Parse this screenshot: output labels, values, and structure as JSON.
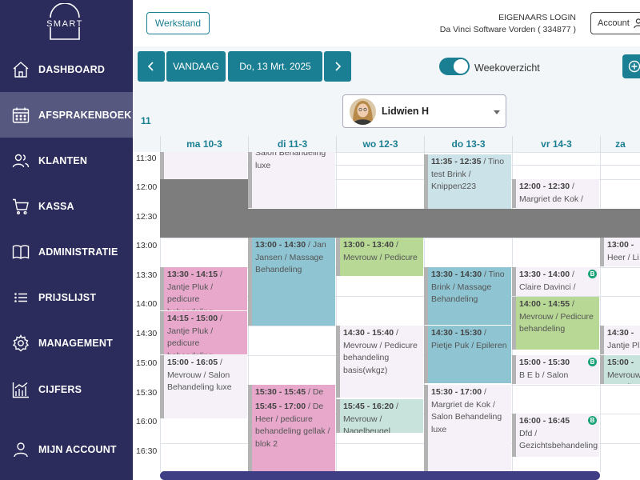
{
  "app": {
    "logo_text": "SMART"
  },
  "sidebar": {
    "items": [
      {
        "label": "DASHBOARD",
        "icon": "home-icon"
      },
      {
        "label": "AFSPRAKENBOEK",
        "icon": "calendar-icon",
        "active": true
      },
      {
        "label": "KLANTEN",
        "icon": "users-icon"
      },
      {
        "label": "KASSA",
        "icon": "cart-icon"
      },
      {
        "label": "ADMINISTRATIE",
        "icon": "book-icon"
      },
      {
        "label": "PRIJSLIJST",
        "icon": "list-icon"
      },
      {
        "label": "MANAGEMENT",
        "icon": "gear-icon"
      },
      {
        "label": "CIJFERS",
        "icon": "chart-icon"
      },
      {
        "label": "MIJN ACCOUNT",
        "icon": "user-icon"
      }
    ]
  },
  "header": {
    "werkstand": "Werkstand",
    "owner_title": "EIGENAARS LOGIN",
    "owner_company": "Da Vinci Software Vorden ( 334877 )",
    "account": "Account"
  },
  "toolbar": {
    "vandaag": "VANDAAG",
    "date": "Do, 13 Mrt. 2025",
    "week_toggle_label": "Weekoverzicht",
    "week_toggle_on": true
  },
  "calendar": {
    "week_number": "11",
    "staff_name": "Lidwien H",
    "days": [
      "ma 10-3",
      "di 11-3",
      "wo 12-3",
      "do 13-3",
      "vr 14-3",
      "za"
    ],
    "times": [
      "11:30",
      "12:00",
      "12:30",
      "13:00",
      "13:30",
      "14:00",
      "14:30",
      "15:00",
      "15:30",
      "16:00",
      "16:30"
    ],
    "appointments": [
      {
        "time": "",
        "text": "Salon Behandeling luxe",
        "color": "#f6f1f9",
        "bar": "#b3b3b3"
      },
      {
        "time": "11:35 - 12:35",
        "text": "Tino test Brink / Knippen223",
        "color": "#cce2e9",
        "bar": "#b3b3b3"
      },
      {
        "time": "12:00 - 12:30",
        "text": "Margriet de Kok /",
        "color": "#f6f1f9",
        "bar": "#b3b3b3"
      },
      {
        "time": "13:00 - 14:30",
        "text": "Jan Jansen / Massage Behandeling",
        "color": "#8fc5d3",
        "bar": "#b3b3b3"
      },
      {
        "time": "13:00 - 13:40",
        "text": "Mevrouw / Pedicure",
        "color": "#b7d995",
        "bar": "#b3b3b3"
      },
      {
        "time": "13:30 - 14:30",
        "text": "Tino Brink / Massage Behandeling",
        "color": "#8fc5d3",
        "bar": "#b3b3b3"
      },
      {
        "time": "13:30 - 14:00",
        "text": "Claire Davinci /",
        "color": "#f6f1f9",
        "bar": "#b3b3b3",
        "badge": "B"
      },
      {
        "time": "13:30 - 14:15",
        "text": "Jantje Pluk / pedicure behandeling",
        "color": "#e7a8cb",
        "bar": "#b3b3b3"
      },
      {
        "time": "14:00 - 14:55",
        "text": "Mevrouw / Pedicure behandeling",
        "color": "#b7d995",
        "bar": "#b3b3b3"
      },
      {
        "time": "14:15 - 15:00",
        "text": "Jantje Pluk / pedicure behandeling",
        "color": "#e7a8cb",
        "bar": "#b3b3b3"
      },
      {
        "time": "14:30 - 15:40",
        "text": "Mevrouw / Pedicure behandeling basis(wkgz)",
        "color": "#f6f1f9",
        "bar": "#b3b3b3"
      },
      {
        "time": "14:30 - 15:30",
        "text": "Pietje Puk / Epileren",
        "color": "#8fc5d3",
        "bar": "#b3b3b3"
      },
      {
        "time": "15:00 - 15:30",
        "text": "B E b / Salon",
        "color": "#f6f1f9",
        "bar": "#b3b3b3",
        "badge": "B"
      },
      {
        "time": "15:00 - 16:05",
        "text": "Mevrouw / Salon Behandeling luxe",
        "color": "#f6f1f9",
        "bar": "#b3b3b3"
      },
      {
        "time": "15:30 - 15:45",
        "text": "De",
        "color": "#e7a8cb",
        "bar": "#b3b3b3"
      },
      {
        "time": "15:30 - 17:00",
        "text": "Margriet de Kok / Salon Behandeling luxe",
        "color": "#f6f1f9",
        "bar": "#b3b3b3"
      },
      {
        "time": "15:45 - 17:00",
        "text": "De Heer / pedicure behandeling gellak / blok 2",
        "color": "#e7a8cb",
        "bar": "#b3b3b3"
      },
      {
        "time": "15:45 - 16:20",
        "text": "Mevrouw / Nagelbeugel",
        "color": "#c8e3dc",
        "bar": "#b3b3b3"
      },
      {
        "time": "16:00 - 16:45",
        "text": "Dfd / Gezichtsbehandeling",
        "color": "#f6f1f9",
        "bar": "#b3b3b3",
        "badge": "B"
      },
      {
        "time": "13:00 -",
        "text": "Heer / Li",
        "color": "#f6f1f9",
        "bar": "#b3b3b3"
      },
      {
        "time": "14:30 -",
        "text": "Jantje Pl",
        "color": "#f6f1f9",
        "bar": "#b3b3b3"
      },
      {
        "time": "15:00 -",
        "text": "Mevrouw Nagelbe",
        "color": "#c8e3dc",
        "bar": "#b3b3b3"
      }
    ]
  },
  "colors": {
    "sidebar_bg": "#2b2c5c",
    "sidebar_active": "#575880",
    "accent": "#1a7f93",
    "blocked": "#7d7d7d",
    "scrollbar": "#3f3e85"
  }
}
